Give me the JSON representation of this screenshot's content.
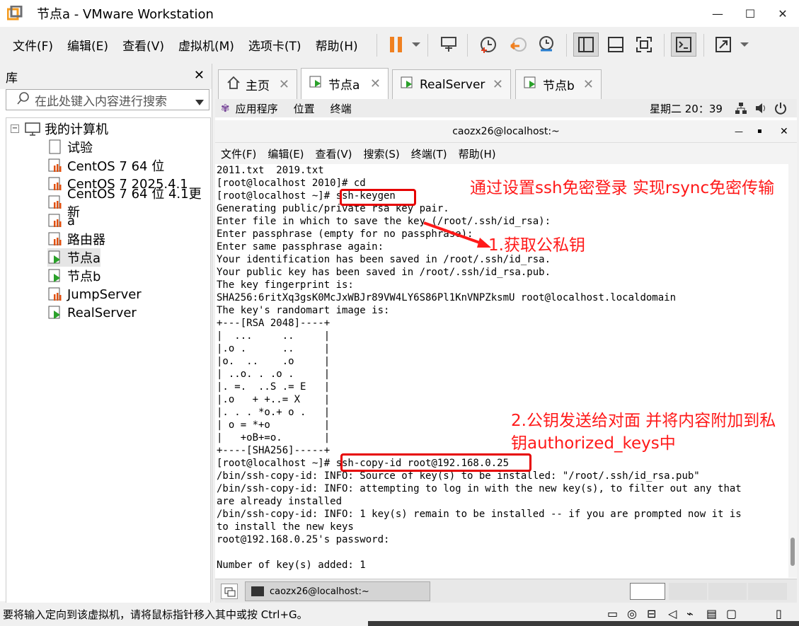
{
  "window": {
    "title": "节点a - VMware Workstation",
    "min_icon": "minimize-icon",
    "max_icon": "maximize-icon",
    "close_icon": "close-icon"
  },
  "menubar": [
    "文件(F)",
    "编辑(E)",
    "查看(V)",
    "虚拟机(M)",
    "选项卡(T)",
    "帮助(H)"
  ],
  "library": {
    "title": "库",
    "search_placeholder": "在此处键入内容进行搜索",
    "tree": [
      {
        "label": "我的计算机",
        "icon": "computer-icon",
        "level": 0
      },
      {
        "label": "试验",
        "icon": "vm-off-icon",
        "level": 1
      },
      {
        "label": "CentOS 7 64 位",
        "icon": "vm-off-icon",
        "level": 1
      },
      {
        "label": "CentOS 7 2025.4.1",
        "icon": "vm-off-icon",
        "level": 1
      },
      {
        "label": "CentOS 7 64 位 4.1更新",
        "icon": "vm-off-icon",
        "level": 1
      },
      {
        "label": "a",
        "icon": "vm-off-icon",
        "level": 1
      },
      {
        "label": "路由器",
        "icon": "vm-off-icon",
        "level": 1
      },
      {
        "label": "节点a",
        "icon": "vm-running-icon",
        "level": 1,
        "selected": true
      },
      {
        "label": "节点b",
        "icon": "vm-running-icon",
        "level": 1
      },
      {
        "label": "JumpServer",
        "icon": "vm-off-icon",
        "level": 1
      },
      {
        "label": "RealServer",
        "icon": "vm-running-icon",
        "level": 1
      }
    ]
  },
  "tabs": [
    {
      "label": "主页",
      "icon": "home-icon"
    },
    {
      "label": "节点a",
      "icon": "vm-running-icon",
      "active": true
    },
    {
      "label": "RealServer",
      "icon": "vm-running-icon"
    },
    {
      "label": "节点b",
      "icon": "vm-running-icon"
    }
  ],
  "gnome": {
    "apps": "应用程序",
    "places": "位置",
    "terminal": "终端",
    "clock": "星期二 20：39"
  },
  "terminal": {
    "title": "caozx26@localhost:~",
    "menu": [
      "文件(F)",
      "编辑(E)",
      "查看(V)",
      "搜索(S)",
      "终端(T)",
      "帮助(H)"
    ],
    "lines": [
      "2011.txt  2019.txt",
      "[root@localhost 2010]# cd",
      "[root@localhost ~]# ssh-keygen",
      "Generating public/private rsa key pair.",
      "Enter file in which to save the key (/root/.ssh/id_rsa):",
      "Enter passphrase (empty for no passphrase):",
      "Enter same passphrase again:",
      "Your identification has been saved in /root/.ssh/id_rsa.",
      "Your public key has been saved in /root/.ssh/id_rsa.pub.",
      "The key fingerprint is:",
      "SHA256:6ritXq3gsK0McJxWBJr89VW4LY6S86Pl1KnVNPZksmU root@localhost.localdomain",
      "The key's randomart image is:",
      "+---[RSA 2048]----+",
      "|  ...     ..     |",
      "|.o .      ..     |",
      "|o.  ..    .o     |",
      "| ..o. . .o .     |",
      "|. =.  ..S .= E   |",
      "|.o   + +..= X    |",
      "|. . . *o.+ o .   |",
      "| o = *+o         |",
      "|   +oB+=o.       |",
      "+----[SHA256]-----+",
      "[root@localhost ~]# ssh-copy-id root@192.168.0.25",
      "/bin/ssh-copy-id: INFO: Source of key(s) to be installed: \"/root/.ssh/id_rsa.pub\"",
      "/bin/ssh-copy-id: INFO: attempting to log in with the new key(s), to filter out any that",
      "are already installed",
      "/bin/ssh-copy-id: INFO: 1 key(s) remain to be installed -- if you are prompted now it is",
      "to install the new keys",
      "root@192.168.0.25's password:",
      "",
      "Number of key(s) added: 1"
    ]
  },
  "annotations": {
    "heading": "通过设置ssh免密登录 实现rsync免密传输",
    "step1": "1.获取公私钥",
    "step2_line1": "2.公钥发送给对面 并将内容附加到私",
    "step2_line2": "钥authorized_keys中",
    "color": "#ff1a1a"
  },
  "vm_taskbar": {
    "item": "caozx26@localhost:~"
  },
  "statusbar": {
    "text": "要将输入定向到该虚拟机，请将鼠标指针移入其中或按 Ctrl+G。"
  }
}
